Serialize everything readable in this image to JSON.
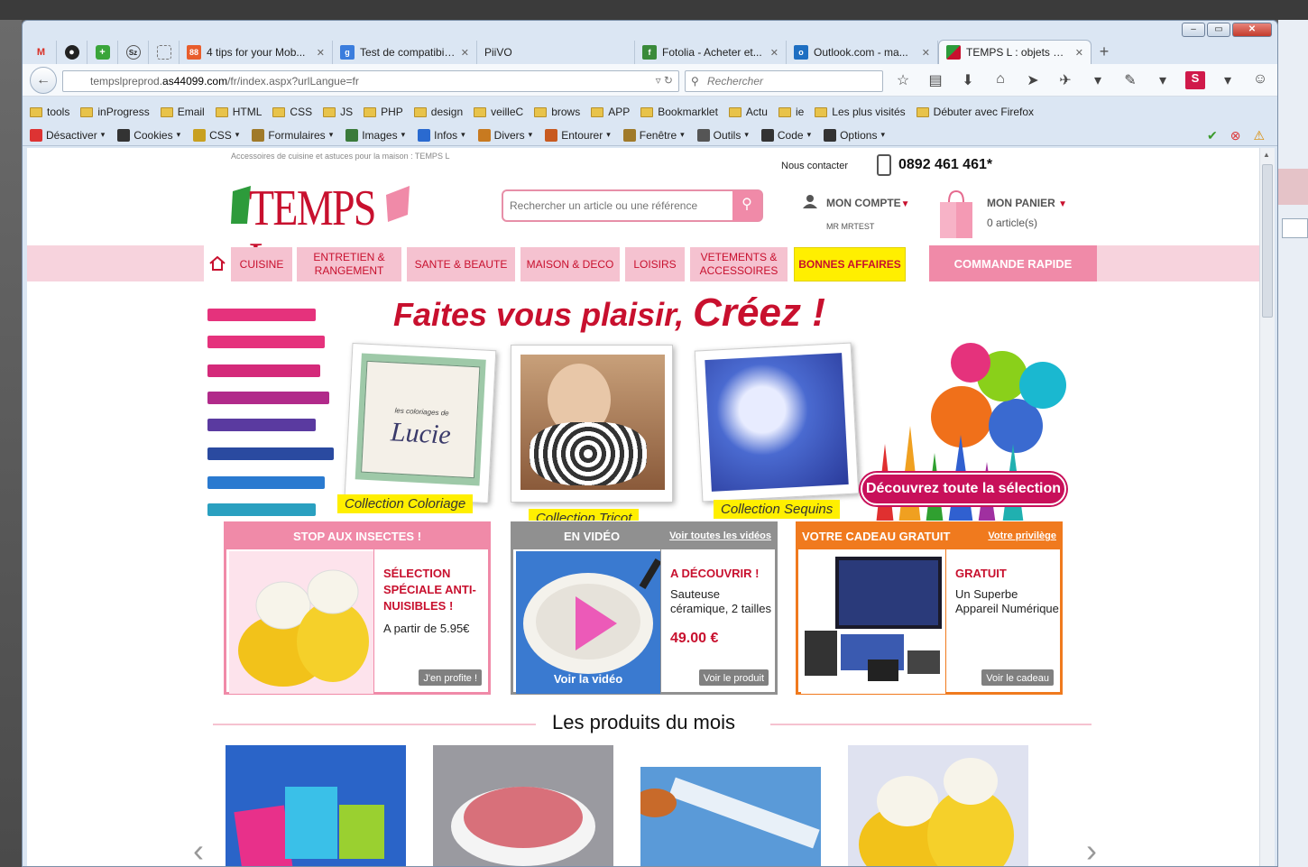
{
  "browser": {
    "tabs": [
      {
        "title": "4 tips for your Mob...",
        "icon": "grid-icon",
        "color": "#e85d2c"
      },
      {
        "title": "Test de compatibili...",
        "icon": "google-icon",
        "color": "#3b7ddd"
      },
      {
        "title": "PiiVO",
        "icon": "",
        "color": ""
      },
      {
        "title": "Fotolia - Acheter et...",
        "icon": "fotolia-icon",
        "color": "#3a8a3a"
      },
      {
        "title": "Outlook.com - ma...",
        "icon": "outlook-icon",
        "color": "#1e6fc2"
      },
      {
        "title": "TEMPS L : objets pr...",
        "icon": "tempsl-icon",
        "color": "#c8102e"
      }
    ],
    "url_prefix": "tempslpreprod.",
    "url_host": "as44099.com",
    "url_path": "/fr/index.aspx?urlLangue=fr",
    "search_placeholder": "Rechercher",
    "bookmarks": [
      "tools",
      "inProgress",
      "Email",
      "HTML",
      "CSS",
      "JS",
      "PHP",
      "design",
      "veilleC",
      "brows",
      "APP",
      "Bookmarklet",
      "Actu",
      "ie",
      "Les plus visités",
      "Débuter avec Firefox"
    ],
    "webdev_menu": [
      "Désactiver",
      "Cookies",
      "CSS",
      "Formulaires",
      "Images",
      "Infos",
      "Divers",
      "Entourer",
      "Fenêtre",
      "Outils",
      "Code",
      "Options"
    ]
  },
  "site": {
    "tagline": "Accessoires de cuisine et astuces pour la maison : TEMPS L",
    "contact": "Nous contacter",
    "phone": "0892 461 461*",
    "logo": "TEMPS L",
    "search_placeholder": "Rechercher un article ou une référence",
    "account_label": "MON COMPTE",
    "account_user": "MR MRTEST",
    "cart_label": "MON PANIER",
    "cart_count": "0 article(s)",
    "menu": [
      "CUISINE",
      "ENTRETIEN & RANGEMENT",
      "SANTE & BEAUTE",
      "MAISON & DECO",
      "LOISIRS",
      "VETEMENTS & ACCESSOIRES",
      "BONNES AFFAIRES"
    ],
    "quick_order": "COMMANDE RAPIDE"
  },
  "banner": {
    "headline": "Faites vous plaisir,",
    "headline_big": "Créez !",
    "book_subtitle": "les coloriages de",
    "book_name": "Lucie",
    "collections": [
      "Collection Coloriage",
      "Collection Tricot",
      "Collection Sequins"
    ],
    "cta": "Découvrez toute la sélection"
  },
  "promos": [
    {
      "header": "STOP AUX INSECTES !",
      "link": "",
      "title": "SÉLECTION SPÉCIALE ANTI-NUISIBLES !",
      "text": "A partir de 5.95€",
      "price": "",
      "button": "J'en profite !",
      "color": "#f08aa8"
    },
    {
      "header": "EN VIDÉO",
      "link": "Voir toutes les vidéos",
      "title": "A DÉCOUVRIR !",
      "text": "Sauteuse céramique, 2 tailles",
      "price": "49.00 €",
      "button": "Voir le produit",
      "overlay": "Voir la vidéo",
      "color": "#909090"
    },
    {
      "header": "VOTRE CADEAU GRATUIT",
      "link": "Votre privilège",
      "title": "GRATUIT",
      "text": "Un Superbe Appareil Numérique",
      "price": "",
      "button": "Voir le cadeau",
      "color": "#f07a1e"
    }
  ],
  "products_title": "Les produits du mois"
}
